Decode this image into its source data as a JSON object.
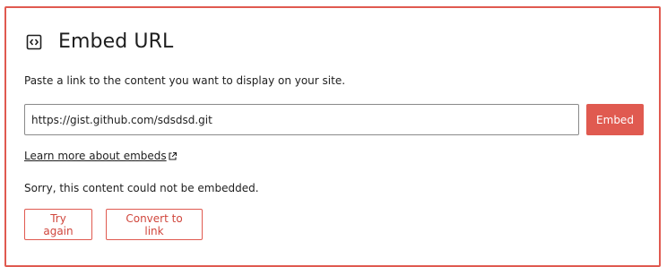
{
  "embed": {
    "title": "Embed URL",
    "icon": "embed-icon",
    "instructions": "Paste a link to the content you want to display on your site.",
    "url_value": "https://gist.github.com/sdsdsd.git",
    "embed_button_label": "Embed",
    "learn_more_label": "Learn more about embeds",
    "learn_more_icon": "external-link-icon",
    "error_message": "Sorry, this content could not be embedded.",
    "try_again_label": "Try again",
    "convert_label": "Convert to link"
  },
  "colors": {
    "accent": "#e05a50",
    "text": "#1e1e1e",
    "input_border": "#8a8a8a"
  }
}
